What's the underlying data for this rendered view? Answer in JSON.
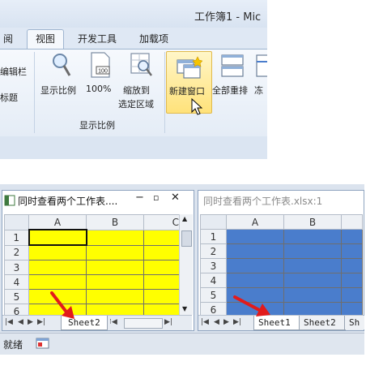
{
  "ribbon": {
    "title": "工作簿1 - Mic",
    "tabs": [
      {
        "label": "阅"
      },
      {
        "label": "视图"
      },
      {
        "label": "开发工具"
      },
      {
        "label": "加载项"
      }
    ],
    "left_cut_labels": [
      "编辑栏",
      "标题"
    ],
    "buttons": {
      "zoom": "显示比例",
      "zoom100": "100%",
      "zoom_selection_line1": "缩放到",
      "zoom_selection_line2": "选定区域",
      "new_window": "新建窗口",
      "arrange_all": "全部重排",
      "freeze": "冻"
    },
    "group_label": "显示比例",
    "icon_100_text": "100"
  },
  "workbook": {
    "left_window": {
      "title": "同时查看两个工作表....",
      "columns": [
        "A",
        "B",
        "C"
      ],
      "rows": [
        "1",
        "2",
        "3",
        "4",
        "5",
        "6"
      ],
      "sheet_tab": "Sheet2",
      "fill_color": "#ffff00"
    },
    "right_window": {
      "title": "同时查看两个工作表.xlsx:1",
      "columns": [
        "A",
        "B"
      ],
      "rows": [
        "1",
        "2",
        "3",
        "4",
        "5",
        "6"
      ],
      "sheet_tabs": [
        "Sheet1",
        "Sheet2",
        "Sh"
      ],
      "fill_color": "#4a7dcc"
    },
    "status_text": "就绪"
  },
  "colors": {
    "accent_arrow": "#e21b1b",
    "ribbon_highlight": "#ffe27a"
  }
}
